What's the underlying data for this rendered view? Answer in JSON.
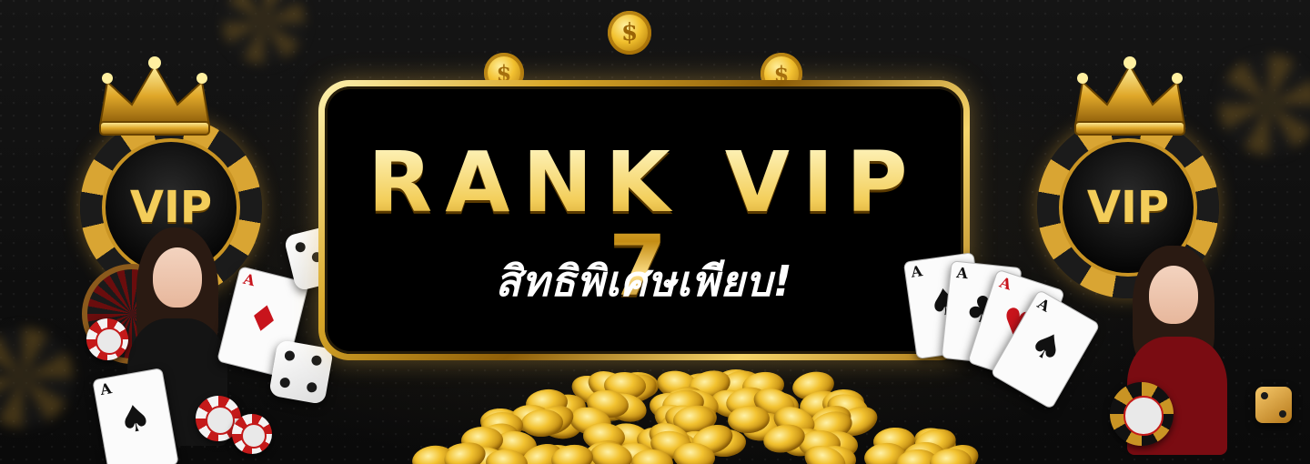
{
  "banner": {
    "title": "RANK VIP 7",
    "subtitle": "สิทธิพิเศษเพียบ!",
    "left_badge": {
      "label": "VIP"
    },
    "right_badge": {
      "label": "VIP"
    }
  },
  "colors": {
    "background": "#0b0b0b",
    "gold": "#f1c64a",
    "panel": "#000000",
    "subtitle": "#ffffff"
  },
  "icons": [
    "crown-icon",
    "vip-chip-icon",
    "dice-icon",
    "playing-card-icon",
    "poker-chip-icon",
    "gold-coin-icon",
    "roulette-wheel-icon"
  ]
}
